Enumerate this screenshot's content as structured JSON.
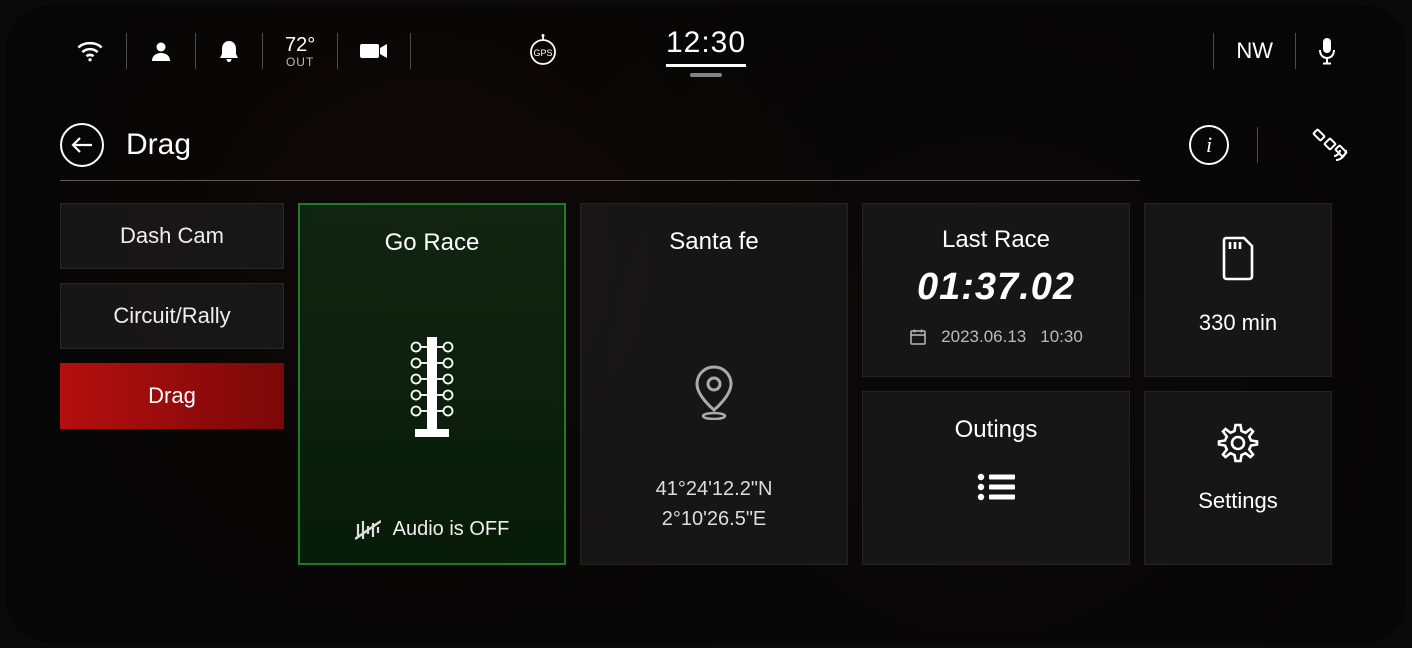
{
  "status": {
    "temp_value": "72°",
    "temp_unit": "OUT",
    "clock": "12:30",
    "compass": "NW"
  },
  "header": {
    "title": "Drag"
  },
  "sidebar": {
    "items": [
      {
        "label": "Dash Cam"
      },
      {
        "label": "Circuit/Rally"
      },
      {
        "label": "Drag"
      }
    ]
  },
  "go_race": {
    "title": "Go Race",
    "audio_status": "Audio is OFF"
  },
  "location": {
    "name": "Santa fe",
    "lat": "41°24'12.2\"N",
    "lon": "2°10'26.5\"E"
  },
  "last_race": {
    "title": "Last Race",
    "time": "01:37.02",
    "date": "2023.06.13",
    "timestamp": "10:30"
  },
  "outings": {
    "title": "Outings"
  },
  "storage": {
    "value": "330 min"
  },
  "settings": {
    "label": "Settings"
  }
}
